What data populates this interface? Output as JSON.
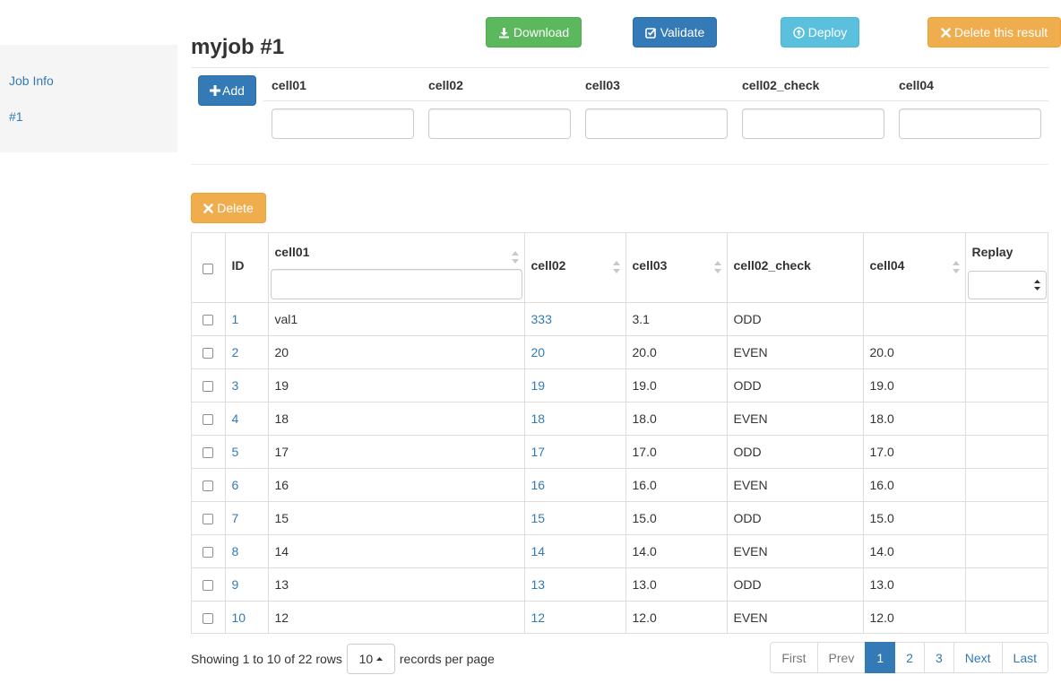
{
  "sidebar": {
    "items": [
      {
        "label": "Job Info"
      },
      {
        "label": "#1"
      }
    ]
  },
  "page": {
    "title": "myjob #1"
  },
  "toolbar": {
    "download_label": "Download",
    "validate_label": "Validate",
    "deploy_label": "Deploy",
    "delete_result_label": "Delete this result"
  },
  "add_form": {
    "add_label": "Add",
    "fields": [
      {
        "label": "cell01",
        "value": ""
      },
      {
        "label": "cell02",
        "value": ""
      },
      {
        "label": "cell03",
        "value": ""
      },
      {
        "label": "cell02_check",
        "value": ""
      },
      {
        "label": "cell04",
        "value": ""
      }
    ]
  },
  "delete_button_label": "Delete",
  "table": {
    "columns": [
      "",
      "ID",
      "cell01",
      "cell02",
      "cell03",
      "cell02_check",
      "cell04",
      "Replay"
    ],
    "rows": [
      {
        "id": "1",
        "cell01": "val1",
        "cell02": "333",
        "cell03": "3.1",
        "cell02_check": "ODD",
        "cell04": "",
        "replay": ""
      },
      {
        "id": "2",
        "cell01": "20",
        "cell02": "20",
        "cell03": "20.0",
        "cell02_check": "EVEN",
        "cell04": "20.0",
        "replay": ""
      },
      {
        "id": "3",
        "cell01": "19",
        "cell02": "19",
        "cell03": "19.0",
        "cell02_check": "ODD",
        "cell04": "19.0",
        "replay": ""
      },
      {
        "id": "4",
        "cell01": "18",
        "cell02": "18",
        "cell03": "18.0",
        "cell02_check": "EVEN",
        "cell04": "18.0",
        "replay": ""
      },
      {
        "id": "5",
        "cell01": "17",
        "cell02": "17",
        "cell03": "17.0",
        "cell02_check": "ODD",
        "cell04": "17.0",
        "replay": ""
      },
      {
        "id": "6",
        "cell01": "16",
        "cell02": "16",
        "cell03": "16.0",
        "cell02_check": "EVEN",
        "cell04": "16.0",
        "replay": ""
      },
      {
        "id": "7",
        "cell01": "15",
        "cell02": "15",
        "cell03": "15.0",
        "cell02_check": "ODD",
        "cell04": "15.0",
        "replay": ""
      },
      {
        "id": "8",
        "cell01": "14",
        "cell02": "14",
        "cell03": "14.0",
        "cell02_check": "EVEN",
        "cell04": "14.0",
        "replay": ""
      },
      {
        "id": "9",
        "cell01": "13",
        "cell02": "13",
        "cell03": "13.0",
        "cell02_check": "ODD",
        "cell04": "13.0",
        "replay": ""
      },
      {
        "id": "10",
        "cell01": "12",
        "cell02": "12",
        "cell03": "12.0",
        "cell02_check": "EVEN",
        "cell04": "12.0",
        "replay": ""
      }
    ]
  },
  "footer": {
    "showing_text": "Showing 1 to 10 of 22 rows",
    "page_size": "10",
    "per_page_text": "records per page"
  },
  "pagination": {
    "first": "First",
    "prev": "Prev",
    "pages": [
      "1",
      "2",
      "3"
    ],
    "active_page": "1",
    "next": "Next",
    "last": "Last"
  },
  "colors": {
    "success": "#5cb85c",
    "primary": "#337ab7",
    "info": "#5bc0de",
    "warning": "#f0ad4e",
    "link": "#337ab7"
  }
}
